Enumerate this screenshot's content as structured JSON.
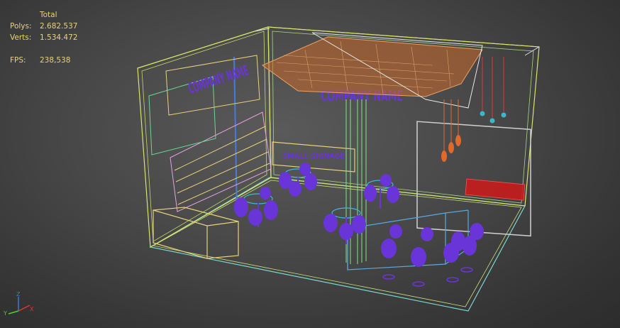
{
  "stats": {
    "total_label": "Total",
    "polys_label": "Polys:",
    "polys_value": "2.682.537",
    "verts_label": "Verts:",
    "verts_value": "1.534.472",
    "fps_label": "FPS:",
    "fps_value": "238,538"
  },
  "scene": {
    "sign_back_wall": "COMPANY NAME",
    "sign_front_wall": "COMPANY NAME",
    "sign_counter": "SMALL SIGNAGE"
  },
  "gizmo": {
    "z_label": "Z",
    "y_label": "Y",
    "x_label": "X"
  },
  "colors": {
    "stats_text": "#e8d27a",
    "furniture": "#6a35d8",
    "ceiling": "#e08a3c",
    "wire_yellow": "#d8e56a",
    "wire_cyan": "#7ad8d0",
    "red_bench": "#d02020"
  }
}
